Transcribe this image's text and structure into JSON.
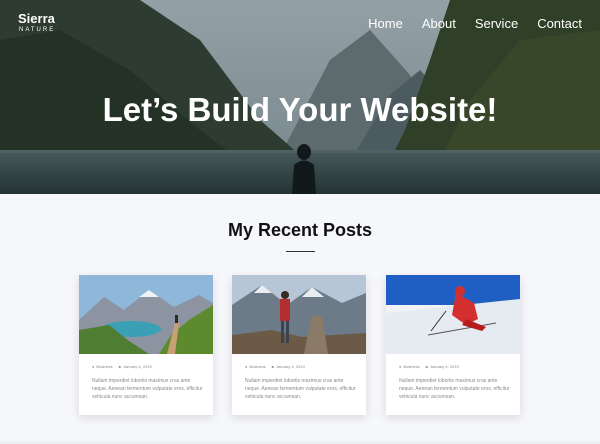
{
  "brand": {
    "name": "Sierra",
    "tagline": "NATURE"
  },
  "nav": {
    "items": [
      "Home",
      "About",
      "Service",
      "Contact"
    ]
  },
  "hero": {
    "title": "Let’s Build Your Website!"
  },
  "posts_section": {
    "title": "My Recent Posts"
  },
  "posts": [
    {
      "author": "Business",
      "date": "January 4, 2019",
      "excerpt": "Nullam imperdiet lobortis maximus cras ante neque. Aenean fermentum vulputate eros, efficitur vehicula nunc accumsan."
    },
    {
      "author": "Business",
      "date": "January 4, 2019",
      "excerpt": "Nullam imperdiet lobortis maximus cras ante neque. Aenean fermentum vulputate eros, efficitur vehicula nunc accumsan."
    },
    {
      "author": "Business",
      "date": "January 4, 2019",
      "excerpt": "Nullam imperdiet lobortis maximus cras ante neque. Aenean fermentum vulputate eros, efficitur vehicula nunc accumsan."
    }
  ],
  "icons": {
    "author": "user-icon",
    "date": "calendar-icon"
  },
  "colors": {
    "text_dark": "#111111",
    "muted": "#8a8a8a",
    "page_bg": "#f6f7fb"
  }
}
